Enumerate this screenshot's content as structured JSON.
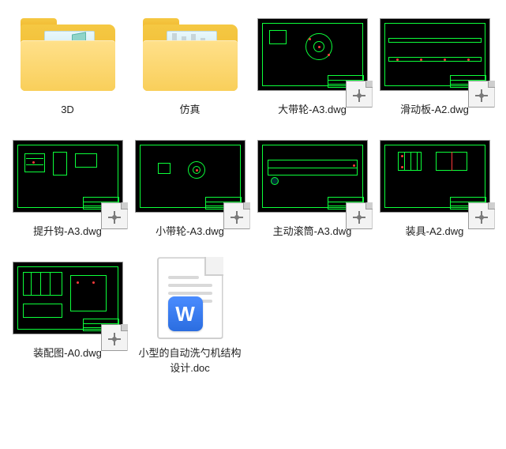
{
  "items": [
    {
      "kind": "folder",
      "label": "3D",
      "preview": "cube"
    },
    {
      "kind": "folder",
      "label": "仿真",
      "preview": "bars"
    },
    {
      "kind": "dwg",
      "label": "大带轮-A3.dwg",
      "variant": "pulley-large"
    },
    {
      "kind": "dwg",
      "label": "滑动板-A2.dwg",
      "variant": "slide-plate"
    },
    {
      "kind": "dwg",
      "label": "提升钩-A3.dwg",
      "variant": "hook"
    },
    {
      "kind": "dwg",
      "label": "小带轮-A3.dwg",
      "variant": "pulley-small"
    },
    {
      "kind": "dwg",
      "label": "主动滚筒-A3.dwg",
      "variant": "roller"
    },
    {
      "kind": "dwg",
      "label": "装具-A2.dwg",
      "variant": "fixture"
    },
    {
      "kind": "dwg",
      "label": "装配图-A0.dwg",
      "variant": "assembly"
    },
    {
      "kind": "doc",
      "label": "小型的自动洗勺机结构设计.doc",
      "badge": "W"
    }
  ]
}
